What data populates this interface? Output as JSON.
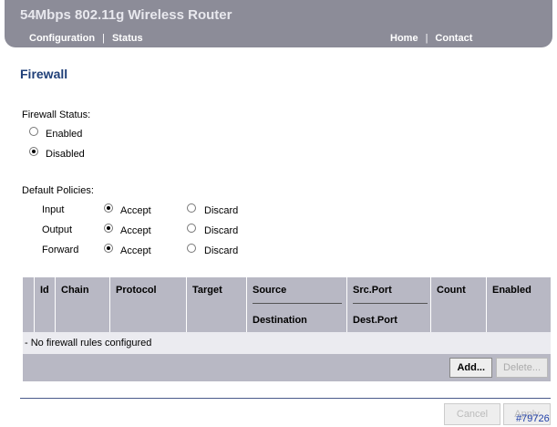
{
  "header": {
    "title": "54Mbps 802.11g Wireless Router",
    "nav_left": [
      "Configuration",
      "Status"
    ],
    "nav_right": [
      "Home",
      "Contact"
    ],
    "separator": "|"
  },
  "page": {
    "title": "Firewall"
  },
  "firewall_status": {
    "label": "Firewall Status:",
    "options": [
      {
        "label": "Enabled",
        "checked": false
      },
      {
        "label": "Disabled",
        "checked": true
      }
    ]
  },
  "default_policies": {
    "label": "Default Policies:",
    "rows": [
      {
        "name": "Input",
        "accept": "Accept",
        "discard": "Discard",
        "selected": "accept"
      },
      {
        "name": "Output",
        "accept": "Accept",
        "discard": "Discard",
        "selected": "accept"
      },
      {
        "name": "Forward",
        "accept": "Accept",
        "discard": "Discard",
        "selected": "accept"
      }
    ]
  },
  "rules_table": {
    "headers": {
      "id": "Id",
      "chain": "Chain",
      "protocol": "Protocol",
      "target": "Target",
      "source": "Source",
      "destination": "Destination",
      "src_port": "Src.Port",
      "dest_port": "Dest.Port",
      "count": "Count",
      "enabled": "Enabled"
    },
    "empty_message": "- No firewall rules configured",
    "add_label": "Add...",
    "delete_label": "Delete..."
  },
  "footer": {
    "cancel_label": "Cancel",
    "apply_label": "Apply",
    "watermark": "#79726"
  }
}
